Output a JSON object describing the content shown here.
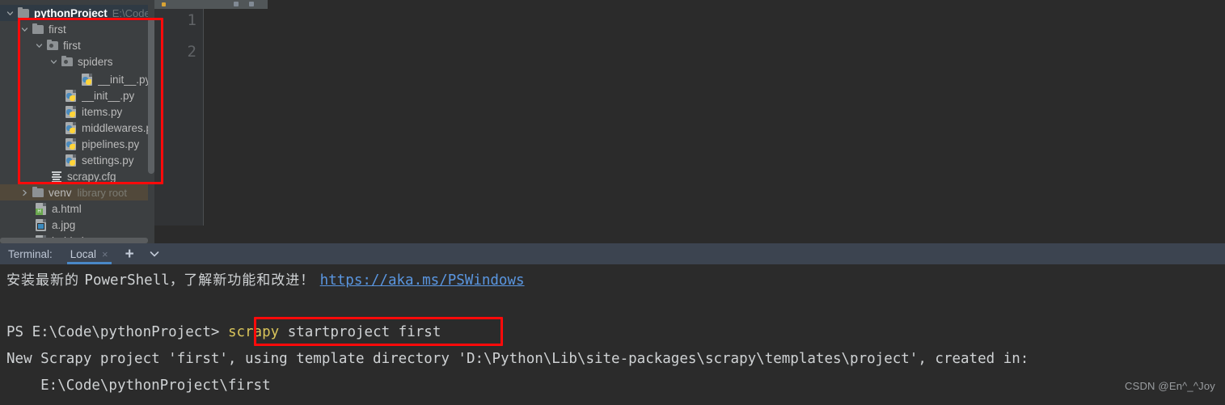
{
  "editor": {
    "line_numbers": [
      "1",
      "2"
    ]
  },
  "project_tree": {
    "rows": [
      {
        "label": "pythonProject",
        "hint": "E:\\Code\\",
        "icon": "folder-icon",
        "twisty": "chevron-down-icon",
        "indent": 0,
        "state": "selected",
        "kind": "folder"
      },
      {
        "label": "first",
        "hint": "",
        "icon": "folder-icon",
        "twisty": "chevron-down-icon",
        "indent": 1,
        "state": "normal",
        "kind": "folder"
      },
      {
        "label": "first",
        "hint": "",
        "icon": "package-folder-icon",
        "twisty": "chevron-down-icon",
        "indent": 2,
        "state": "normal",
        "kind": "package"
      },
      {
        "label": "spiders",
        "hint": "",
        "icon": "package-folder-icon",
        "twisty": "chevron-down-icon",
        "indent": 3,
        "state": "normal",
        "kind": "package"
      },
      {
        "label": "__init__.py",
        "hint": "",
        "icon": "python-file-icon",
        "twisty": "",
        "indent": 4,
        "state": "normal",
        "kind": "python"
      },
      {
        "label": "__init__.py",
        "hint": "",
        "icon": "python-file-icon",
        "twisty": "",
        "indent": 3,
        "state": "normal",
        "kind": "python"
      },
      {
        "label": "items.py",
        "hint": "",
        "icon": "python-file-icon",
        "twisty": "",
        "indent": 3,
        "state": "normal",
        "kind": "python"
      },
      {
        "label": "middlewares.py",
        "hint": "",
        "icon": "python-file-icon",
        "twisty": "",
        "indent": 3,
        "state": "normal",
        "kind": "python"
      },
      {
        "label": "pipelines.py",
        "hint": "",
        "icon": "python-file-icon",
        "twisty": "",
        "indent": 3,
        "state": "normal",
        "kind": "python"
      },
      {
        "label": "settings.py",
        "hint": "",
        "icon": "python-file-icon",
        "twisty": "",
        "indent": 3,
        "state": "normal",
        "kind": "python"
      },
      {
        "label": "scrapy.cfg",
        "hint": "",
        "icon": "config-file-icon",
        "twisty": "",
        "indent": 2,
        "state": "normal",
        "kind": "cfg"
      },
      {
        "label": "venv",
        "hint": "library root",
        "icon": "folder-icon",
        "twisty": "chevron-right-icon",
        "indent": 1,
        "state": "highlighted",
        "kind": "folder"
      },
      {
        "label": "a.html",
        "hint": "",
        "icon": "html-file-icon",
        "twisty": "",
        "indent": 2,
        "state": "normal",
        "kind": "html"
      },
      {
        "label": "a.jpg",
        "hint": "",
        "icon": "image-file-icon",
        "twisty": "",
        "indent": 2,
        "state": "normal",
        "kind": "image"
      },
      {
        "label": "baidu.jpg",
        "hint": "",
        "icon": "image-file-icon",
        "twisty": "",
        "indent": 2,
        "state": "normal",
        "kind": "image"
      }
    ]
  },
  "terminal": {
    "title": "Terminal:",
    "tab": {
      "label": "Local",
      "close": "×"
    },
    "add_label": "+",
    "notice": {
      "text_cn_1": "安装最新的 ",
      "text_en": "PowerShell，",
      "text_cn_2": "了解新功能和改进！ ",
      "link": "https://aka.ms/PSWindows"
    },
    "prompt": "PS E:\\Code\\pythonProject>",
    "command_keyword": "scrapy",
    "command_rest": " startproject first",
    "output_line_1": "New Scrapy project 'first', using template directory 'D:\\Python\\Lib\\site-packages\\scrapy\\templates\\project', created in:",
    "output_line_2": "    E:\\Code\\pythonProject\\first"
  },
  "watermark": {
    "text": "CSDN @En^_^Joy"
  },
  "colors": {
    "sidebar_bg": "#3c3f41",
    "editor_bg": "#2b2b2b",
    "gutter_bg": "#313335",
    "terminal_header_bg": "#3c4450",
    "selection_bg": "#2f3a44",
    "highlight_bg": "#51483a",
    "accent_blue": "#4a88c7",
    "link_blue": "#5a96e0",
    "annotation_red": "#ff0a0a",
    "keyword_yellow": "#d9c45a"
  }
}
